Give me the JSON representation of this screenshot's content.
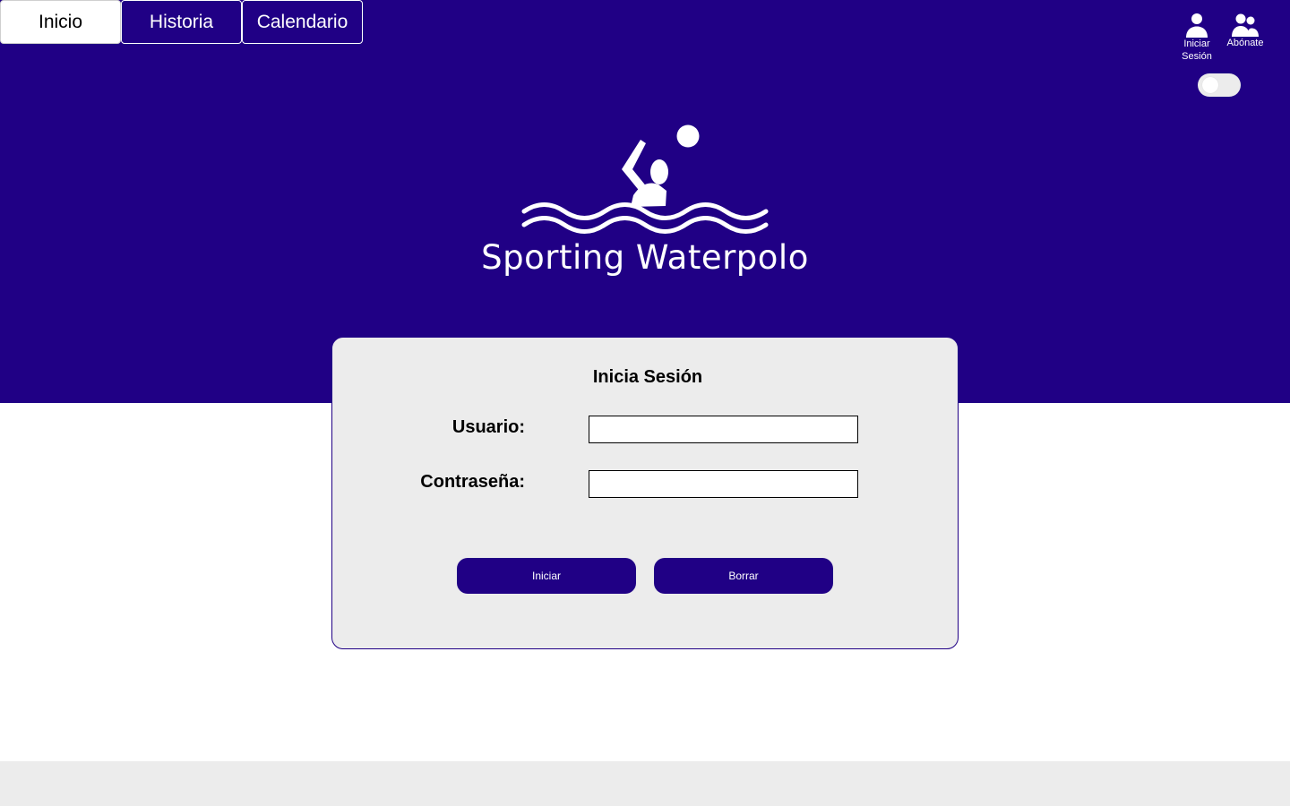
{
  "nav": {
    "tabs": [
      {
        "label": "Inicio",
        "active": true
      },
      {
        "label": "Historia",
        "active": false
      },
      {
        "label": "Calendario",
        "active": false
      }
    ]
  },
  "account": {
    "login": {
      "label": "Iniciar\nSesión",
      "icon": "user-icon"
    },
    "subscribe": {
      "label": "Abónate",
      "icon": "users-icon"
    }
  },
  "theme_toggle": {
    "on": false
  },
  "brand": {
    "name": "Sporting Waterpolo",
    "logo_icon": "waterpolo-swimmer-icon"
  },
  "login_form": {
    "title": "Inicia Sesión",
    "username_label": "Usuario:",
    "username_value": "",
    "password_label": "Contraseña:",
    "password_value": "",
    "submit_label": "Iniciar",
    "reset_label": "Borrar"
  },
  "colors": {
    "primary": "#200085",
    "panel": "#ececec",
    "white": "#ffffff"
  }
}
